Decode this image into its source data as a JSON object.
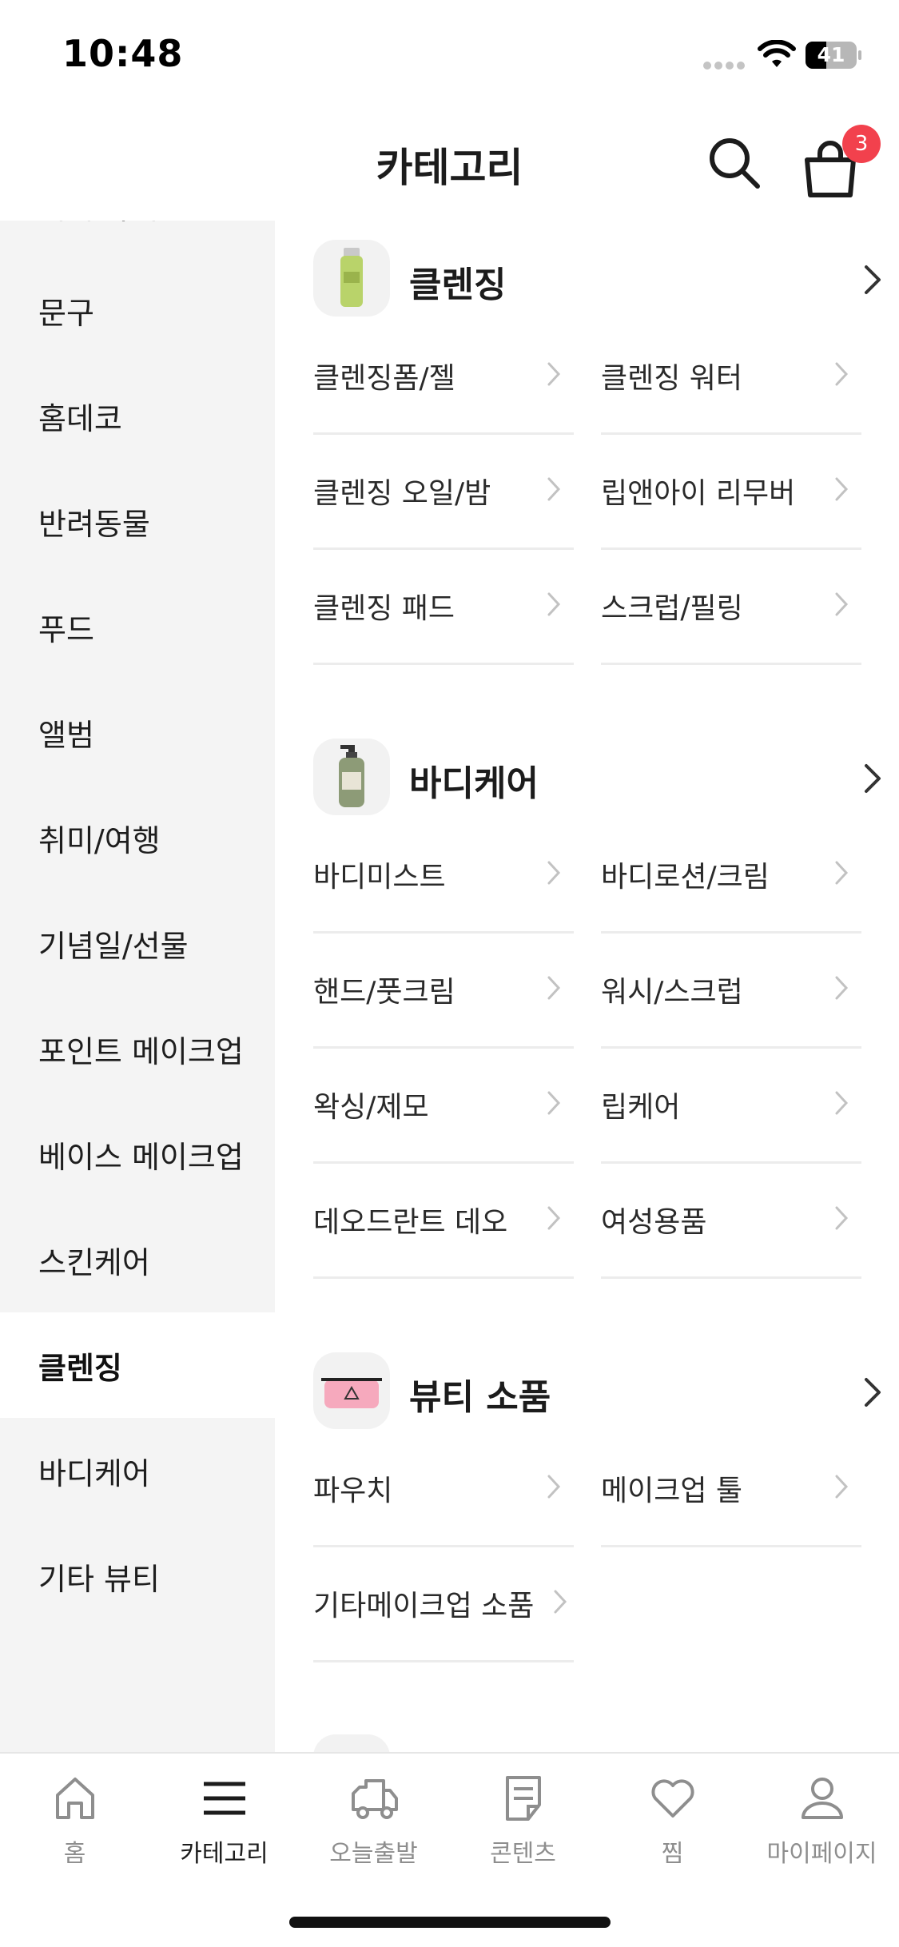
{
  "status_bar": {
    "time": "10:48",
    "battery_text": "41",
    "battery_level": 0.41
  },
  "header": {
    "title": "카테고리",
    "cart_count": "3"
  },
  "sidebar": {
    "items": [
      {
        "label": "디지털/가전"
      },
      {
        "label": "문구"
      },
      {
        "label": "홈데코"
      },
      {
        "label": "반려동물"
      },
      {
        "label": "푸드"
      },
      {
        "label": "앨범"
      },
      {
        "label": "취미/여행"
      },
      {
        "label": "기념일/선물"
      },
      {
        "label": "포인트 메이크업"
      },
      {
        "label": "베이스 메이크업"
      },
      {
        "label": "스킨케어"
      },
      {
        "label": "클렌징"
      },
      {
        "label": "바디케어"
      },
      {
        "label": "기타 뷰티"
      }
    ],
    "active": "클렌징"
  },
  "sections": [
    {
      "title": "클렌징",
      "thumb": "cleansing-bottle",
      "items": [
        "클렌징폼/젤",
        "클렌징 워터",
        "클렌징 오일/밤",
        "립앤아이 리무버",
        "클렌징 패드",
        "스크럽/필링"
      ]
    },
    {
      "title": "바디케어",
      "thumb": "pump-bottle",
      "items": [
        "바디미스트",
        "바디로션/크림",
        "핸드/풋크림",
        "워시/스크럽",
        "왁싱/제모",
        "립케어",
        "데오드란트 데오",
        "여성용품"
      ]
    },
    {
      "title": "뷰티 소품",
      "thumb": "pink-pouch",
      "items": [
        "파우치",
        "메이크업 툴",
        "기타메이크업 소품"
      ]
    }
  ],
  "bottom_nav": {
    "items": [
      {
        "label": "홈",
        "icon": "home-icon"
      },
      {
        "label": "카테고리",
        "icon": "menu-icon"
      },
      {
        "label": "오늘출발",
        "icon": "truck-icon"
      },
      {
        "label": "콘텐츠",
        "icon": "document-icon"
      },
      {
        "label": "찜",
        "icon": "heart-icon"
      },
      {
        "label": "마이페이지",
        "icon": "user-icon"
      }
    ],
    "active": "카테고리"
  },
  "colors": {
    "badge": "#f2414d",
    "sidebar_bg": "#f4f4f4",
    "divider": "#ececec",
    "inactive_text": "#8e8e8e"
  }
}
